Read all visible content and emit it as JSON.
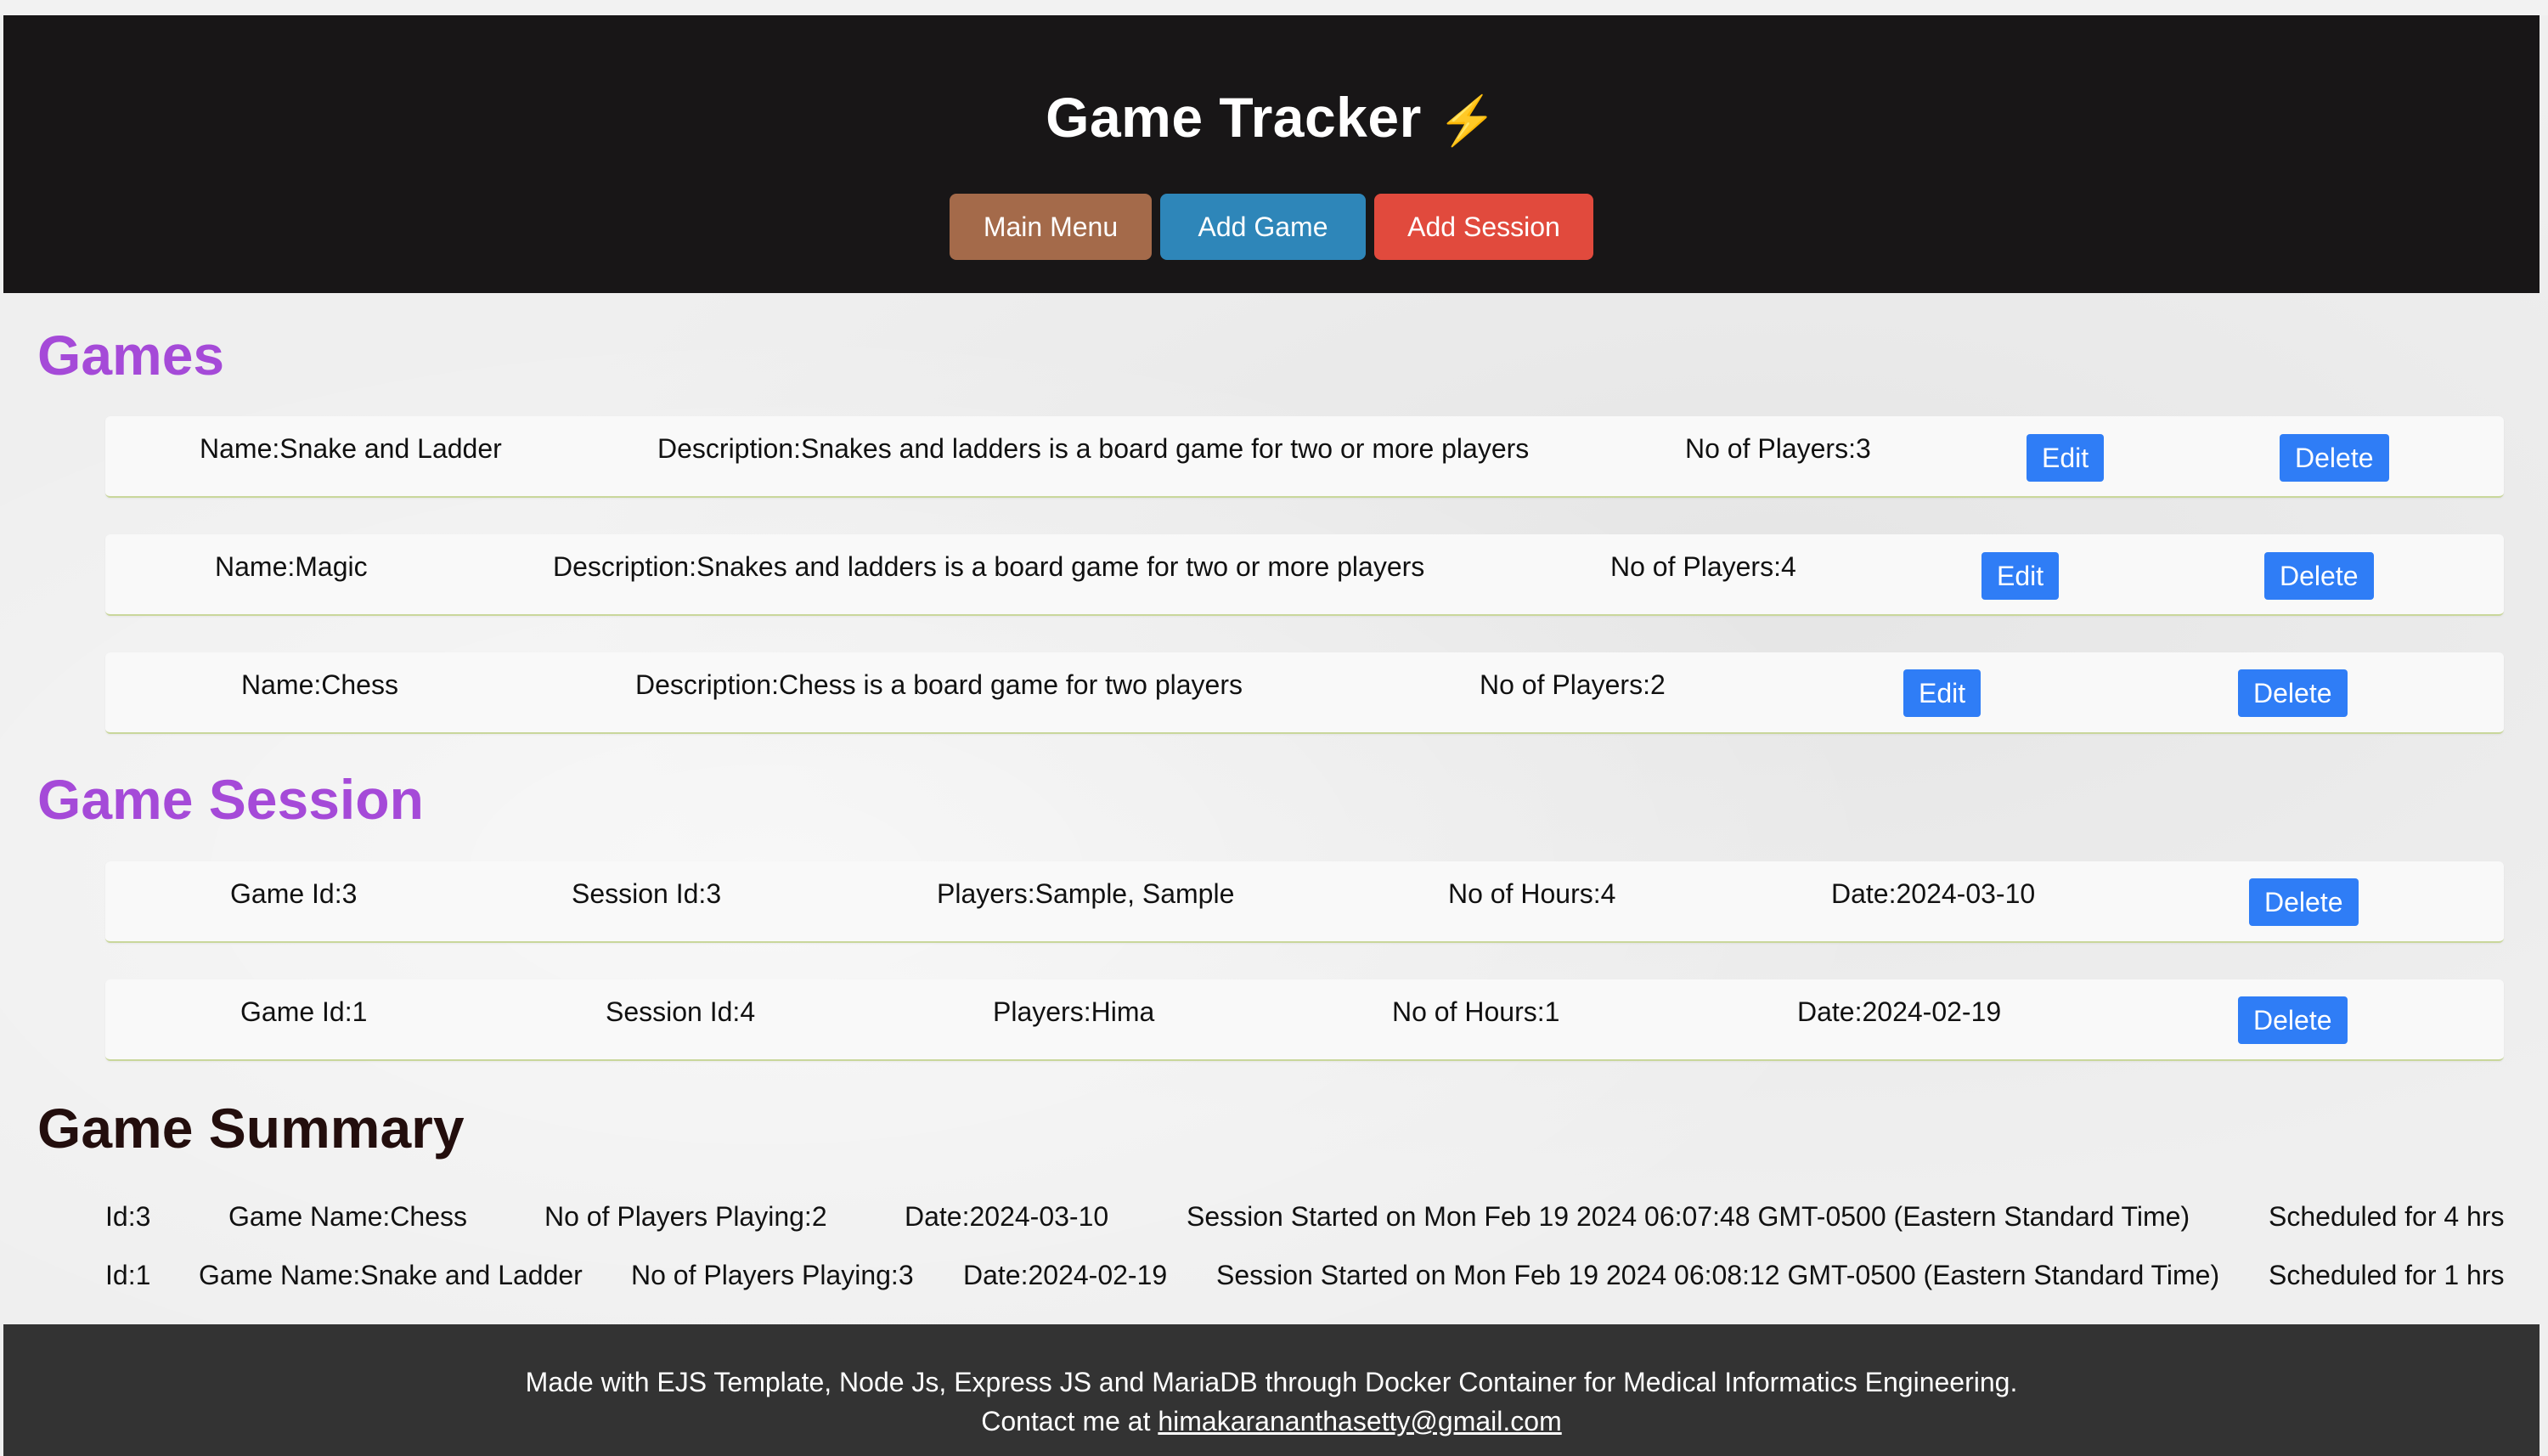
{
  "header": {
    "title": "Game Tracker",
    "title_icon": "⚡",
    "nav": {
      "main_menu": "Main Menu",
      "add_game": "Add Game",
      "add_session": "Add Session"
    }
  },
  "colors": {
    "header_bg": "#181617",
    "section_title": "#a54ad8",
    "button_blue": "#2f7df6",
    "main_menu": "#a46a4a",
    "add_game": "#2e86b9",
    "add_session": "#e14a3d"
  },
  "games": {
    "title": "Games",
    "edit_label": "Edit",
    "delete_label": "Delete",
    "items": [
      {
        "name": "Name:Snake and Ladder",
        "description": "Description:Snakes and ladders is a board game for two or more players",
        "players": "No of Players:3"
      },
      {
        "name": "Name:Magic",
        "description": "Description:Snakes and ladders is a board game for two or more players",
        "players": "No of Players:4"
      },
      {
        "name": "Name:Chess",
        "description": "Description:Chess is a board game for two players",
        "players": "No of Players:2"
      }
    ]
  },
  "sessions": {
    "title": "Game Session",
    "delete_label": "Delete",
    "items": [
      {
        "game_id": "Game Id:3",
        "session_id": "Session Id:3",
        "players": "Players:Sample, Sample",
        "hours": "No of Hours:4",
        "date": "Date:2024-03-10"
      },
      {
        "game_id": "Game Id:1",
        "session_id": "Session Id:4",
        "players": "Players:Hima",
        "hours": "No of Hours:1",
        "date": "Date:2024-02-19"
      }
    ]
  },
  "summary": {
    "title": "Game Summary",
    "items": [
      {
        "id": "Id:3",
        "game_name": "Game Name:Chess",
        "players": "No of Players Playing:2",
        "date": "Date:2024-03-10",
        "started": "Session Started on Mon Feb 19 2024 06:07:48 GMT-0500 (Eastern Standard Time)",
        "scheduled": "Scheduled for 4 hrs"
      },
      {
        "id": "Id:1",
        "game_name": "Game Name:Snake and Ladder",
        "players": "No of Players Playing:3",
        "date": "Date:2024-02-19",
        "started": "Session Started on Mon Feb 19 2024 06:08:12 GMT-0500 (Eastern Standard Time)",
        "scheduled": "Scheduled for 1 hrs"
      }
    ]
  },
  "footer": {
    "line1": "Made with EJS Template, Node Js, Express JS and MariaDB through Docker Container for Medical Informatics Engineering.",
    "contact_prefix": "Contact me at ",
    "email": "himakarananthasetty@gmail.com"
  }
}
